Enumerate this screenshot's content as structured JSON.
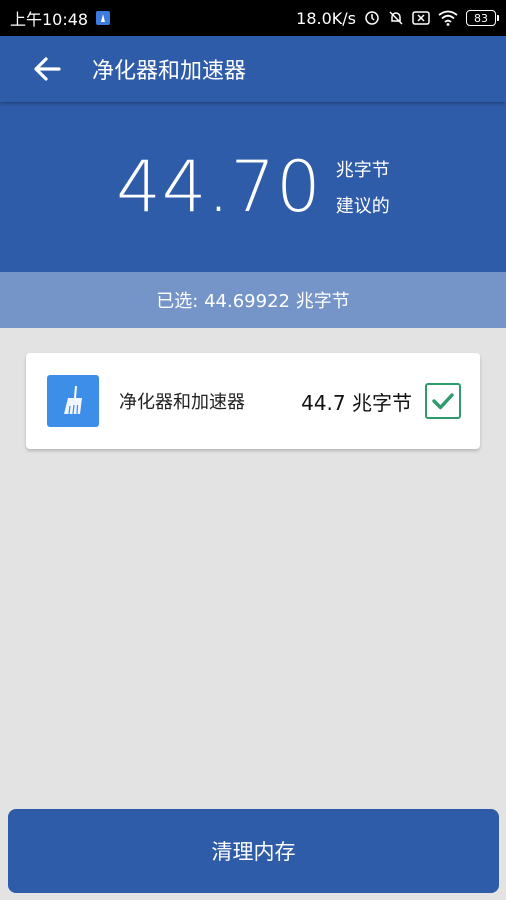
{
  "status_bar": {
    "time": "上午10:48",
    "speed": "18.0K/s",
    "battery": "83"
  },
  "app_bar": {
    "title": "净化器和加速器"
  },
  "summary": {
    "amount": "44.70",
    "unit": "兆字节",
    "note": "建议的"
  },
  "selected": {
    "text": "已选: 44.69922 兆字节"
  },
  "items": [
    {
      "name": "净化器和加速器",
      "size": "44.7 兆字节",
      "checked": true
    }
  ],
  "action": {
    "label": "清理内存"
  },
  "colors": {
    "primary": "#2f5ca8",
    "selected_bar": "#7595c9",
    "background": "#e3e3e3",
    "check": "#2e9b6a",
    "app_icon": "#3d8ee8"
  }
}
